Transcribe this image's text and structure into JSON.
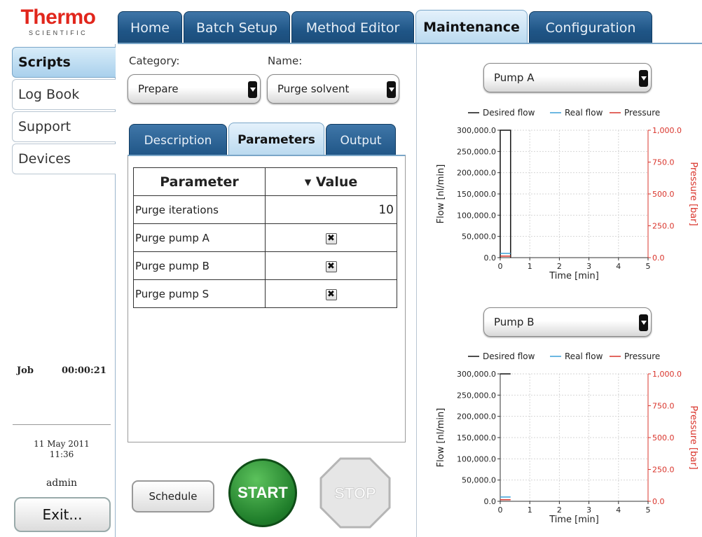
{
  "logo": {
    "line1": "Thermo",
    "line2": "SCIENTIFIC"
  },
  "top_tabs": [
    {
      "label": "Home",
      "active": false
    },
    {
      "label": "Batch Setup",
      "active": false
    },
    {
      "label": "Method Editor",
      "active": false
    },
    {
      "label": "Maintenance",
      "active": true
    },
    {
      "label": "Configuration",
      "active": false
    }
  ],
  "sidebar": {
    "items": [
      {
        "label": "Scripts",
        "active": true
      },
      {
        "label": "Log Book",
        "active": false
      },
      {
        "label": "Support",
        "active": false
      },
      {
        "label": "Devices",
        "active": false
      }
    ],
    "job_label": "Job",
    "job_time": "00:00:21",
    "date": "11 May 2011",
    "time": "11:36",
    "user": "admin",
    "exit_label": "Exit..."
  },
  "scripts": {
    "category_label": "Category:",
    "category_value": "Prepare",
    "name_label": "Name:",
    "name_value": "Purge solvent",
    "subtabs": [
      {
        "label": "Description",
        "active": false
      },
      {
        "label": "Parameters",
        "active": true
      },
      {
        "label": "Output",
        "active": false
      }
    ],
    "table": {
      "headers": [
        "Parameter",
        "Value"
      ],
      "sort_indicator": "▾",
      "rows": [
        {
          "name": "Purge iterations",
          "value": "10",
          "type": "number"
        },
        {
          "name": "Purge pump A",
          "value": "✖",
          "type": "checkbox"
        },
        {
          "name": "Purge pump B",
          "value": "✖",
          "type": "checkbox"
        },
        {
          "name": "Purge pump S",
          "value": "✖",
          "type": "checkbox"
        }
      ]
    },
    "schedule_label": "Schedule",
    "start_label": "START",
    "stop_label": "STOP"
  },
  "pumps": {
    "pump_a_label": "Pump A",
    "pump_b_label": "Pump B"
  },
  "colors": {
    "desired": "#111111",
    "real": "#3aa0d8",
    "pressure": "#d9342b",
    "tab_blue": "#1f5586",
    "start_green": "#1f7d2a"
  },
  "chart_data": [
    {
      "type": "line",
      "title": "",
      "xlabel": "Time [min]",
      "ylabel": "Flow [nl/min]",
      "y2label": "Pressure [bar]",
      "xlim": [
        0,
        5
      ],
      "ylim": [
        0,
        300000
      ],
      "y2lim": [
        0,
        1000
      ],
      "x_ticks": [
        "0",
        "1",
        "2",
        "3",
        "4",
        "5"
      ],
      "y_ticks": [
        "0.0",
        "50,000.0",
        "100,000.0",
        "150,000.0",
        "200,000.0",
        "250,000.0",
        "300,000.0"
      ],
      "y2_ticks": [
        "0.0",
        "250.0",
        "500.0",
        "750.0",
        "1,000.0"
      ],
      "legend": [
        "Desired flow",
        "Real flow",
        "Pressure"
      ],
      "legend_position": "top",
      "grid": true,
      "series": [
        {
          "name": "Desired flow",
          "axis": "left",
          "x": [
            0,
            0,
            0.35,
            0.35
          ],
          "y": [
            0,
            300000,
            300000,
            0
          ]
        },
        {
          "name": "Real flow",
          "axis": "left",
          "x": [
            0,
            0.35
          ],
          "y": [
            10000,
            10000
          ]
        },
        {
          "name": "Pressure",
          "axis": "right",
          "x": [
            0,
            0.35
          ],
          "y": [
            12,
            12
          ]
        }
      ]
    },
    {
      "type": "line",
      "title": "",
      "xlabel": "Time [min]",
      "ylabel": "Flow [nl/min]",
      "y2label": "Pressure [bar]",
      "xlim": [
        0,
        5
      ],
      "ylim": [
        0,
        300000
      ],
      "y2lim": [
        0,
        1000
      ],
      "x_ticks": [
        "0",
        "1",
        "2",
        "3",
        "4",
        "5"
      ],
      "y_ticks": [
        "0.0",
        "50,000.0",
        "100,000.0",
        "150,000.0",
        "200,000.0",
        "250,000.0",
        "300,000.0"
      ],
      "y2_ticks": [
        "0.0",
        "250.0",
        "500.0",
        "750.0",
        "1,000.0"
      ],
      "legend": [
        "Desired flow",
        "Real flow",
        "Pressure"
      ],
      "legend_position": "top",
      "grid": true,
      "series": [
        {
          "name": "Desired flow",
          "axis": "left",
          "x": [
            0,
            0.1,
            0.35
          ],
          "y": [
            300000,
            300000,
            300000
          ]
        },
        {
          "name": "Real flow",
          "axis": "left",
          "x": [
            0,
            0.35
          ],
          "y": [
            10000,
            10000
          ]
        },
        {
          "name": "Pressure",
          "axis": "right",
          "x": [
            0,
            0.35
          ],
          "y": [
            12,
            12
          ]
        }
      ]
    }
  ]
}
